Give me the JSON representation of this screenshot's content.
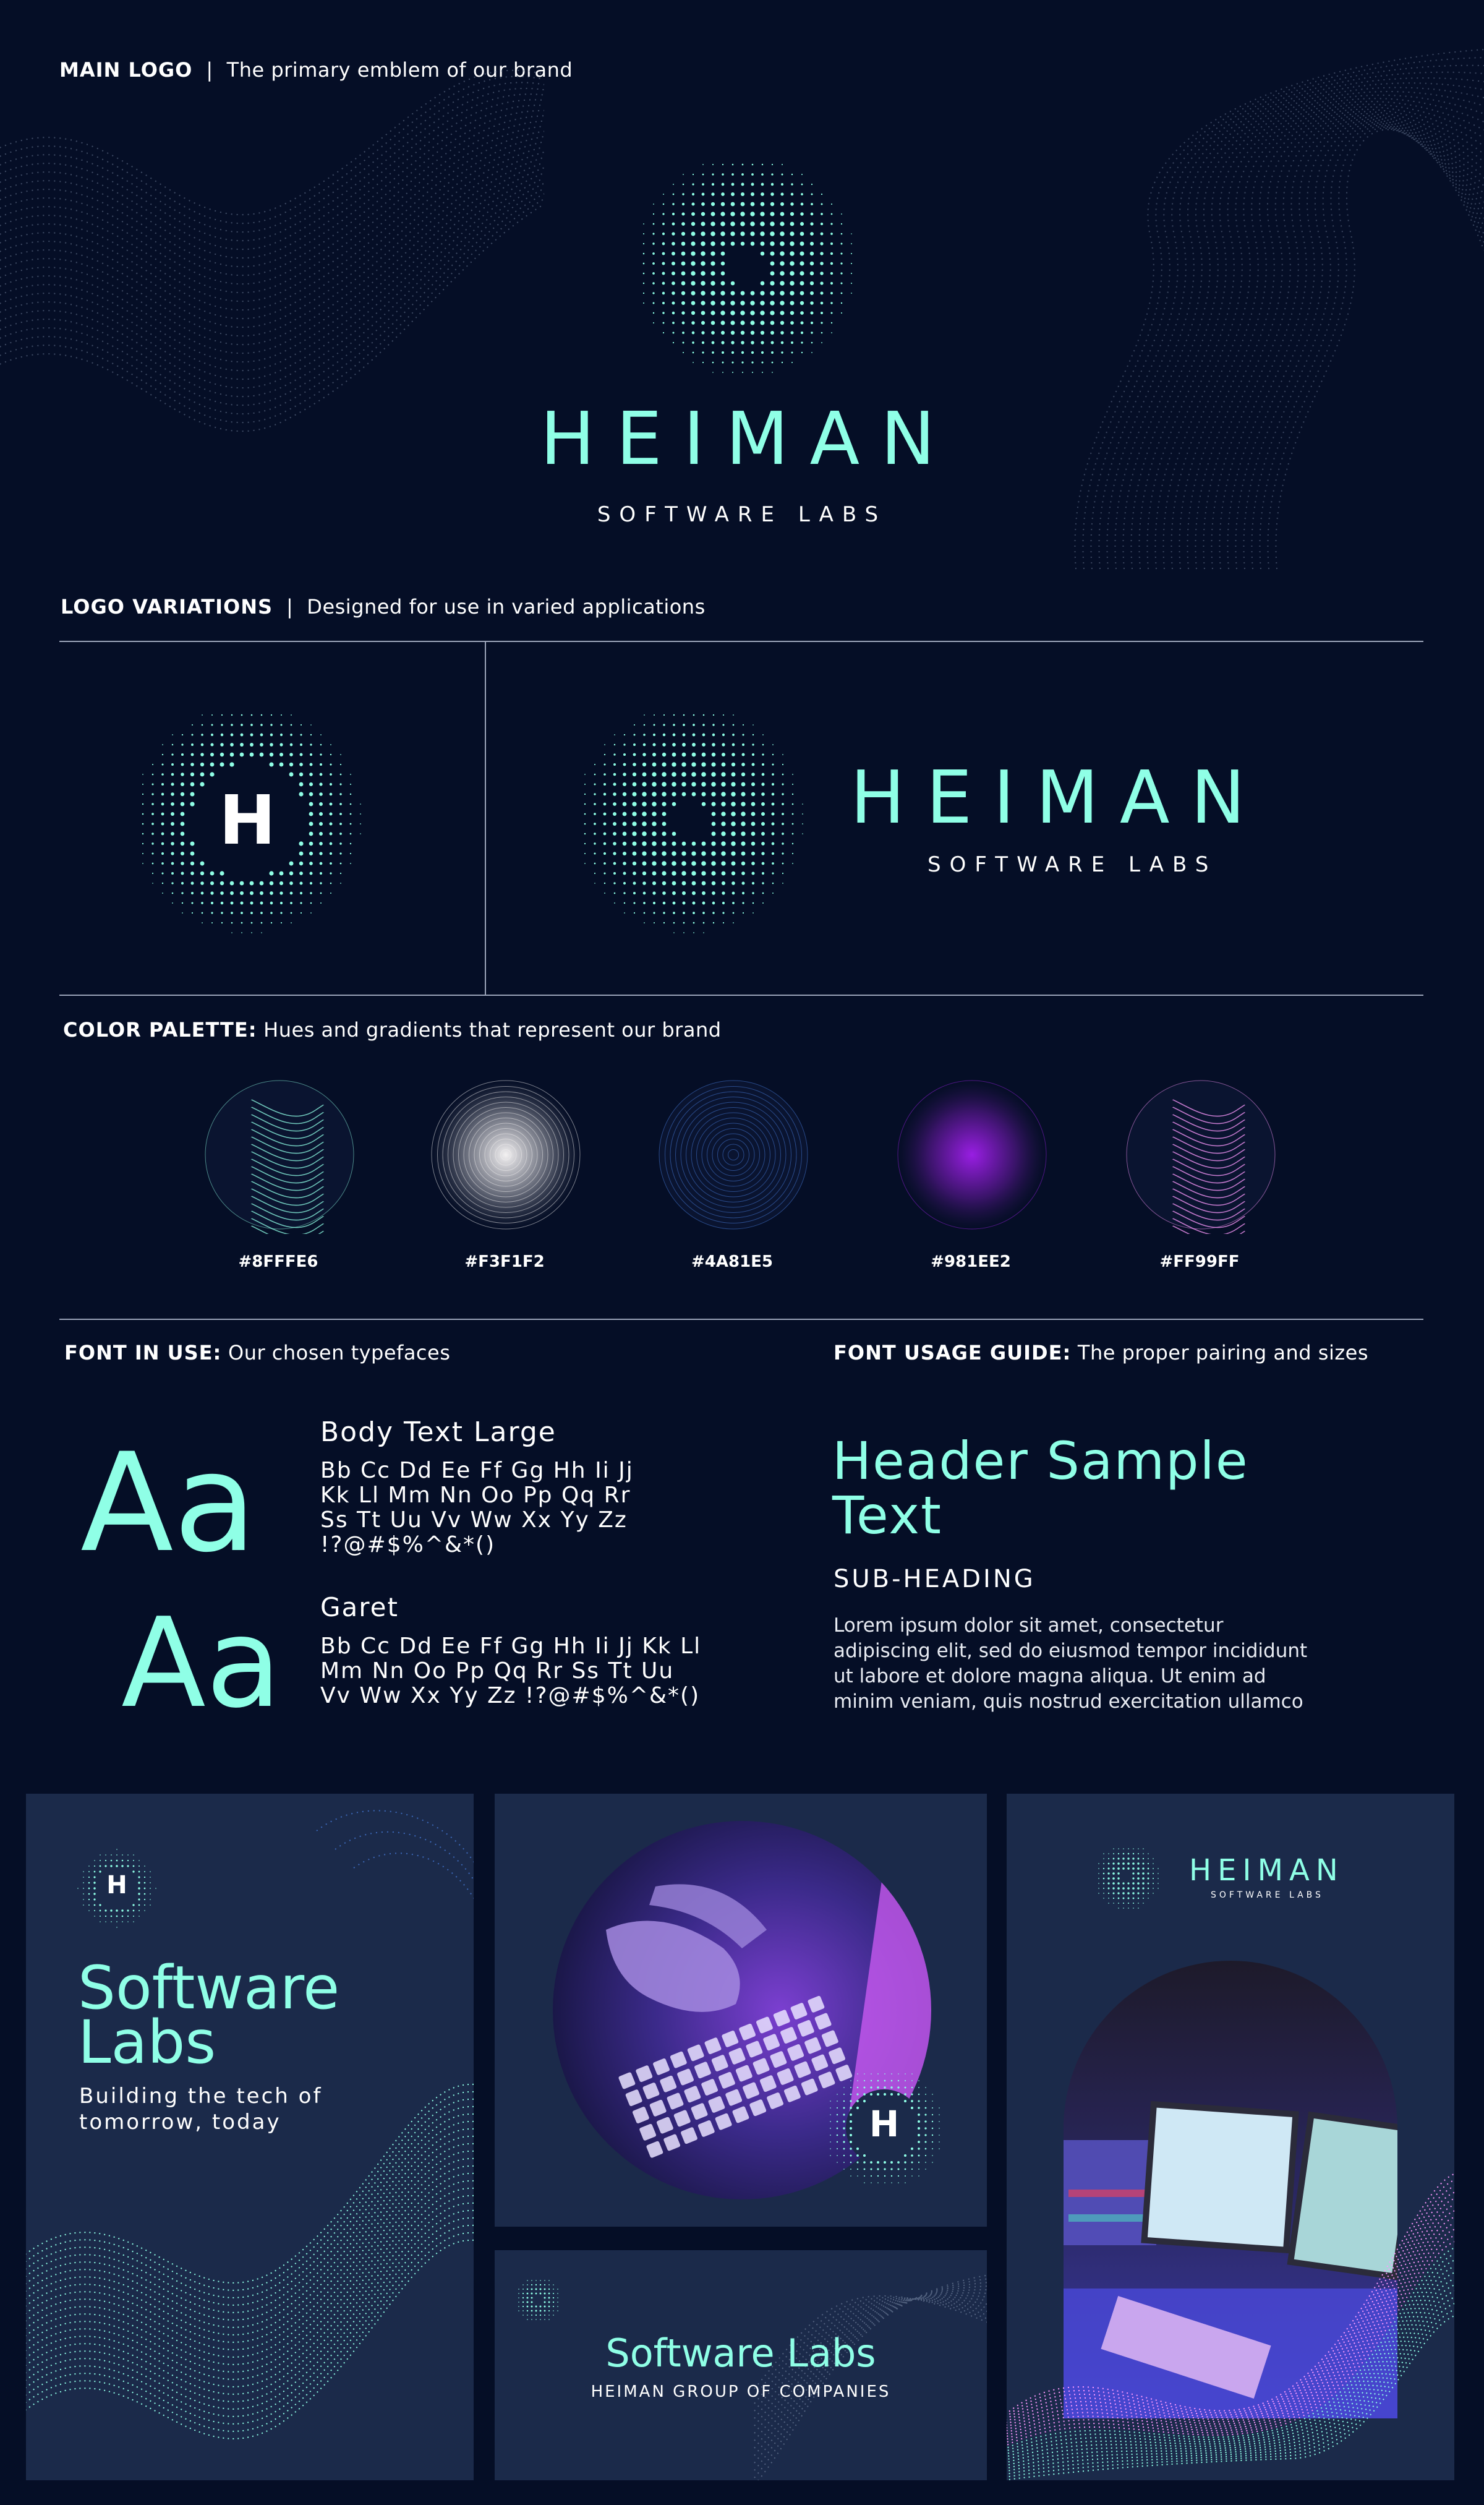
{
  "main_logo": {
    "label": "MAIN LOGO",
    "description": "The primary emblem of our brand",
    "brand_name": "HEIMAN",
    "brand_sub": "SOFTWARE LABS"
  },
  "logo_variations": {
    "label": "LOGO VARIATIONS",
    "description": "Designed for use in varied applications",
    "monogram_letter": "H",
    "brand_name": "HEIMAN",
    "brand_sub": "SOFTWARE LABS"
  },
  "color_palette": {
    "label": "COLOR PALETTE:",
    "description": "Hues and gradients that represent our brand",
    "swatches": [
      {
        "hex": "#8FFFE6",
        "color": "#8fffe6"
      },
      {
        "hex": "#F3F1F2",
        "color": "#f3f1f2"
      },
      {
        "hex": "#4A81E5",
        "color": "#4a81e5"
      },
      {
        "hex": "#981EE2",
        "color": "#981ee2"
      },
      {
        "hex": "#FF99FF",
        "color": "#ff99ff"
      }
    ]
  },
  "fonts": {
    "label": "FONT IN USE:",
    "description": "Our chosen typefaces",
    "font1_sample": "Aa",
    "font1_name": "Body Text Large",
    "font1_glyphs": [
      "Bb Cc Dd Ee Ff Gg Hh Ii Jj",
      "Kk Ll Mm Nn Oo Pp Qq Rr",
      "Ss Tt Uu Vv Ww Xx Yy Zz",
      "!?@#$%^&*()"
    ],
    "font2_sample": "Aa",
    "font2_name": "Garet",
    "font2_glyphs": [
      "Bb Cc Dd Ee Ff Gg Hh Ii Jj Kk Ll",
      "Mm Nn Oo Pp Qq Rr Ss Tt Uu",
      "Vv Ww Xx Yy Zz !?@#$%^&*()"
    ]
  },
  "font_usage": {
    "label": "FONT USAGE GUIDE:",
    "description": "The proper pairing and sizes",
    "header_lines": [
      "Header Sample",
      "Text"
    ],
    "subheading": "SUB-HEADING",
    "body_lines": [
      "Lorem ipsum dolor sit amet, consectetur",
      "adipiscing elit, sed do eiusmod tempor incididunt",
      "ut labore et dolore magna aliqua. Ut enim ad",
      "minim veniam, quis nostrud exercitation ullamco"
    ]
  },
  "mockups": {
    "poster": {
      "monogram": "H",
      "title_lines": [
        "Software",
        "Labs"
      ],
      "tagline_lines": [
        "Building the tech of",
        "tomorrow, today"
      ]
    },
    "photo_card": {
      "monogram": "H"
    },
    "banner": {
      "title": "Software Labs",
      "subtitle": "HEIMAN GROUP OF COMPANIES"
    },
    "tall_card": {
      "brand_name": "HEIMAN",
      "brand_sub": "SOFTWARE LABS"
    }
  }
}
